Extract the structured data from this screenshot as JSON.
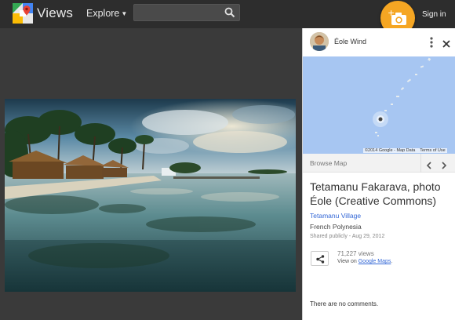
{
  "header": {
    "brand": "Views",
    "explore_label": "Explore",
    "search_placeholder": "",
    "signin_label": "Sign in"
  },
  "author": {
    "name": "Éole Wind"
  },
  "map": {
    "credit": "©2014 Google - Map Data",
    "terms": "Terms of Use"
  },
  "browse": {
    "label": "Browse Map"
  },
  "photo_info": {
    "title": "Tetamanu Fakarava, photo Éole (Creative Commons)",
    "place_link": "Tetamanu Village",
    "region": "French Polynesia",
    "shared": "Shared publicly - Aug 29, 2012",
    "views": "71,227 views",
    "view_on_prefix": "View on ",
    "view_on_link": "Google Maps",
    "view_on_suffix": "."
  },
  "comments": {
    "empty_text": "There are no comments."
  },
  "colors": {
    "topbar": "#2d2d2d",
    "background": "#3a3a3a",
    "camera": "#f5a623",
    "link": "#3367d6",
    "map_water": "#a7c6f2"
  },
  "icons": [
    "maps-logo-icon",
    "search-icon",
    "add-photo-camera-icon",
    "more-vert-icon",
    "close-icon",
    "chevron-left-icon",
    "chevron-right-icon",
    "share-icon"
  ]
}
